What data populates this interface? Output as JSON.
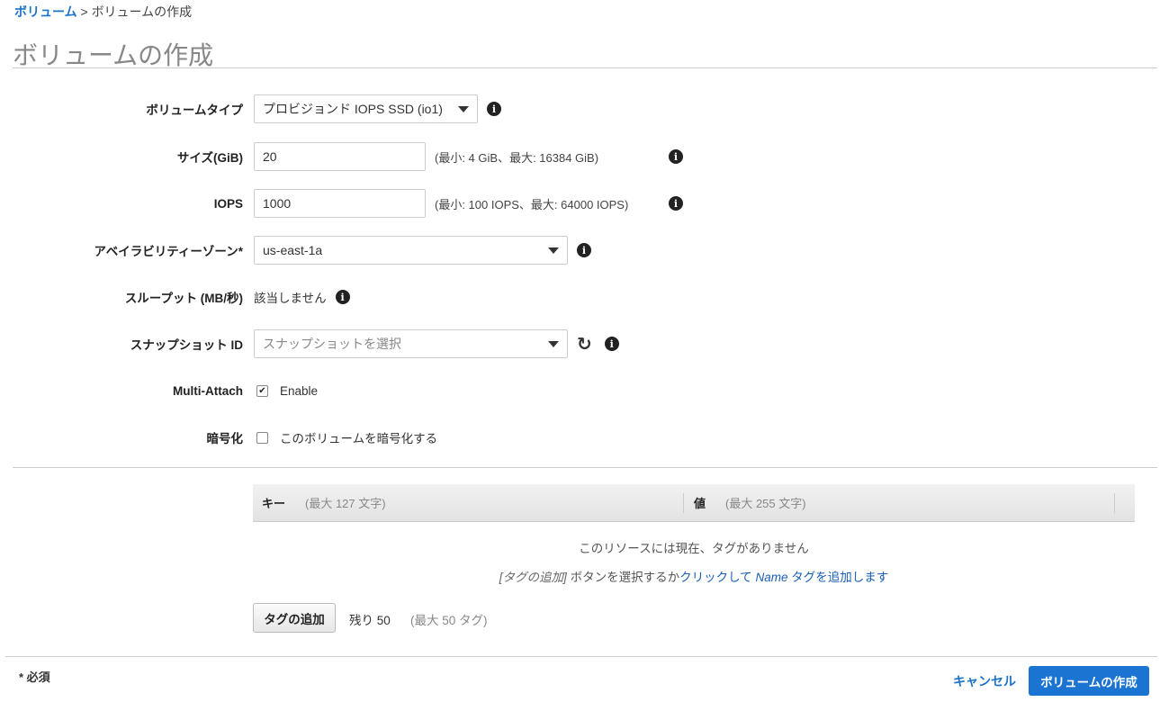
{
  "breadcrumb": {
    "parent": "ボリューム",
    "sep": ">",
    "current": "ボリュームの作成"
  },
  "title": "ボリュームの作成",
  "form": {
    "volume_type": {
      "label": "ボリュームタイプ",
      "value": "プロビジョンド IOPS SSD (io1)"
    },
    "size": {
      "label": "サイズ(GiB)",
      "value": "20",
      "hint": "(最小: 4 GiB、最大: 16384 GiB)"
    },
    "iops": {
      "label": "IOPS",
      "value": "1000",
      "hint": "(最小: 100 IOPS、最大: 64000 IOPS)"
    },
    "az": {
      "label": "アベイラビリティーゾーン*",
      "value": "us-east-1a"
    },
    "throughput": {
      "label": "スループット (MB/秒)",
      "value": "該当しません"
    },
    "snapshot": {
      "label": "スナップショット ID",
      "placeholder": "スナップショットを選択"
    },
    "multi_attach": {
      "label": "Multi-Attach",
      "option": "Enable",
      "checked": true
    },
    "encryption": {
      "label": "暗号化",
      "option": "このボリュームを暗号化する",
      "checked": false
    }
  },
  "tags": {
    "key_header": "キー",
    "key_hint": "(最大 127 文字)",
    "value_header": "値",
    "value_hint": "(最大 255 文字)",
    "empty": "このリソースには現在、タグがありません",
    "instr_prefix": "[タグの追加]",
    "instr_mid": " ボタンを選択するか",
    "instr_link": "クリックして",
    "instr_name": " Name ",
    "instr_link2": "タグを追加します",
    "add_button": "タグの追加",
    "remaining": "残り 50",
    "max": "(最大 50 タグ)"
  },
  "footer": {
    "required": "* 必須",
    "cancel": "キャンセル",
    "create": "ボリュームの作成"
  }
}
